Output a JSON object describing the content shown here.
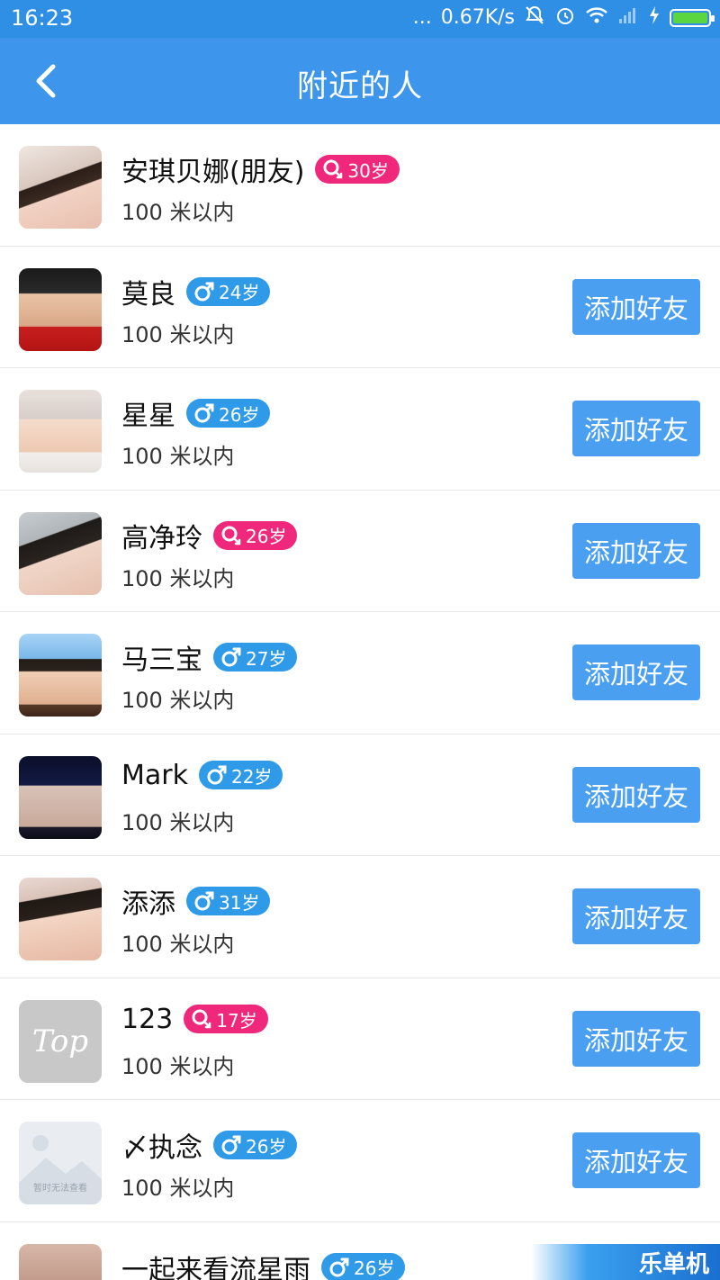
{
  "status_bar": {
    "time": "16:23",
    "dots": "...",
    "net_speed": "0.67K/s",
    "icons": [
      "alarm-muted-icon",
      "alarm-clock-icon",
      "wifi-icon",
      "signal-icon",
      "charging-icon",
      "battery-icon"
    ],
    "battery_color": "#5cd640"
  },
  "header": {
    "title": "附近的人",
    "back_icon": "chevron-left-icon",
    "bar_color": "#3d96eb"
  },
  "colors": {
    "male_badge": "#2f9be8",
    "female_badge": "#f0287c",
    "add_button": "#4a9ff0"
  },
  "people": [
    {
      "name": "安琪贝娜(朋友)",
      "gender": "female",
      "age": "30岁",
      "distance": "100 米以内",
      "button": ""
    },
    {
      "name": "莫良",
      "gender": "male",
      "age": "24岁",
      "distance": "100 米以内",
      "button": "添加好友"
    },
    {
      "name": "星星",
      "gender": "male",
      "age": "26岁",
      "distance": "100 米以内",
      "button": "添加好友"
    },
    {
      "name": "高净玲",
      "gender": "female",
      "age": "26岁",
      "distance": "100 米以内",
      "button": "添加好友"
    },
    {
      "name": "马三宝",
      "gender": "male",
      "age": "27岁",
      "distance": "100 米以内",
      "button": "添加好友"
    },
    {
      "name": "Mark",
      "gender": "male",
      "age": "22岁",
      "distance": "100 米以内",
      "button": "添加好友"
    },
    {
      "name": "添添",
      "gender": "male",
      "age": "31岁",
      "distance": "100 米以内",
      "button": "添加好友"
    },
    {
      "name": "123",
      "gender": "female",
      "age": "17岁",
      "distance": "100 米以内",
      "button": "添加好友",
      "avatar_text": "Top"
    },
    {
      "name": "〆执念",
      "gender": "male",
      "age": "26岁",
      "distance": "100 米以内",
      "button": "添加好友",
      "avatar_text": "暂时无法查看"
    },
    {
      "name": "一起来看流星雨",
      "gender": "male",
      "age": "26岁",
      "distance": "",
      "button": ""
    }
  ],
  "watermark": "乐单机"
}
